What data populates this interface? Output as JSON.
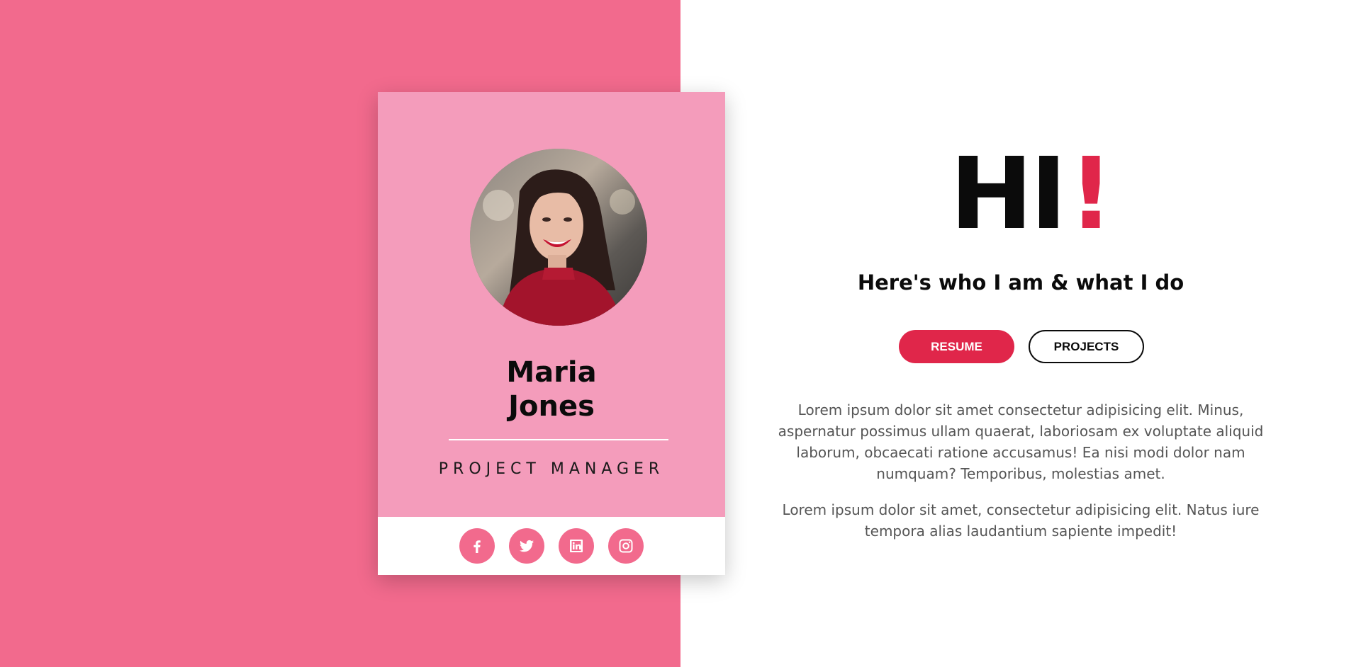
{
  "colors": {
    "left_panel_bg": "#f26a8d",
    "card_bg": "#f49cbb",
    "accent_red": "#e0264a",
    "text_dark": "#0b0b0b",
    "text_muted": "#555555"
  },
  "profile": {
    "first_name": "Maria",
    "last_name": "Jones",
    "role": "PROJECT MANAGER",
    "photo": "portrait-photo"
  },
  "social": [
    {
      "icon": "facebook-icon"
    },
    {
      "icon": "twitter-icon"
    },
    {
      "icon": "linkedin-icon"
    },
    {
      "icon": "instagram-icon"
    }
  ],
  "hero": {
    "greeting": "HI",
    "exclamation": "!",
    "tagline": "Here's who I am & what I do"
  },
  "buttons": {
    "resume_label": "RESUME",
    "projects_label": "PROJECTS"
  },
  "about": {
    "paragraph_1": "Lorem ipsum dolor sit amet consectetur adipisicing elit. Minus, aspernatur possimus ullam quaerat, laboriosam ex voluptate aliquid laborum, obcaecati ratione accusamus! Ea nisi modi dolor nam numquam? Temporibus, molestias amet.",
    "paragraph_2": "Lorem ipsum dolor sit amet, consectetur adipisicing elit. Natus iure tempora alias laudantium sapiente impedit!"
  }
}
